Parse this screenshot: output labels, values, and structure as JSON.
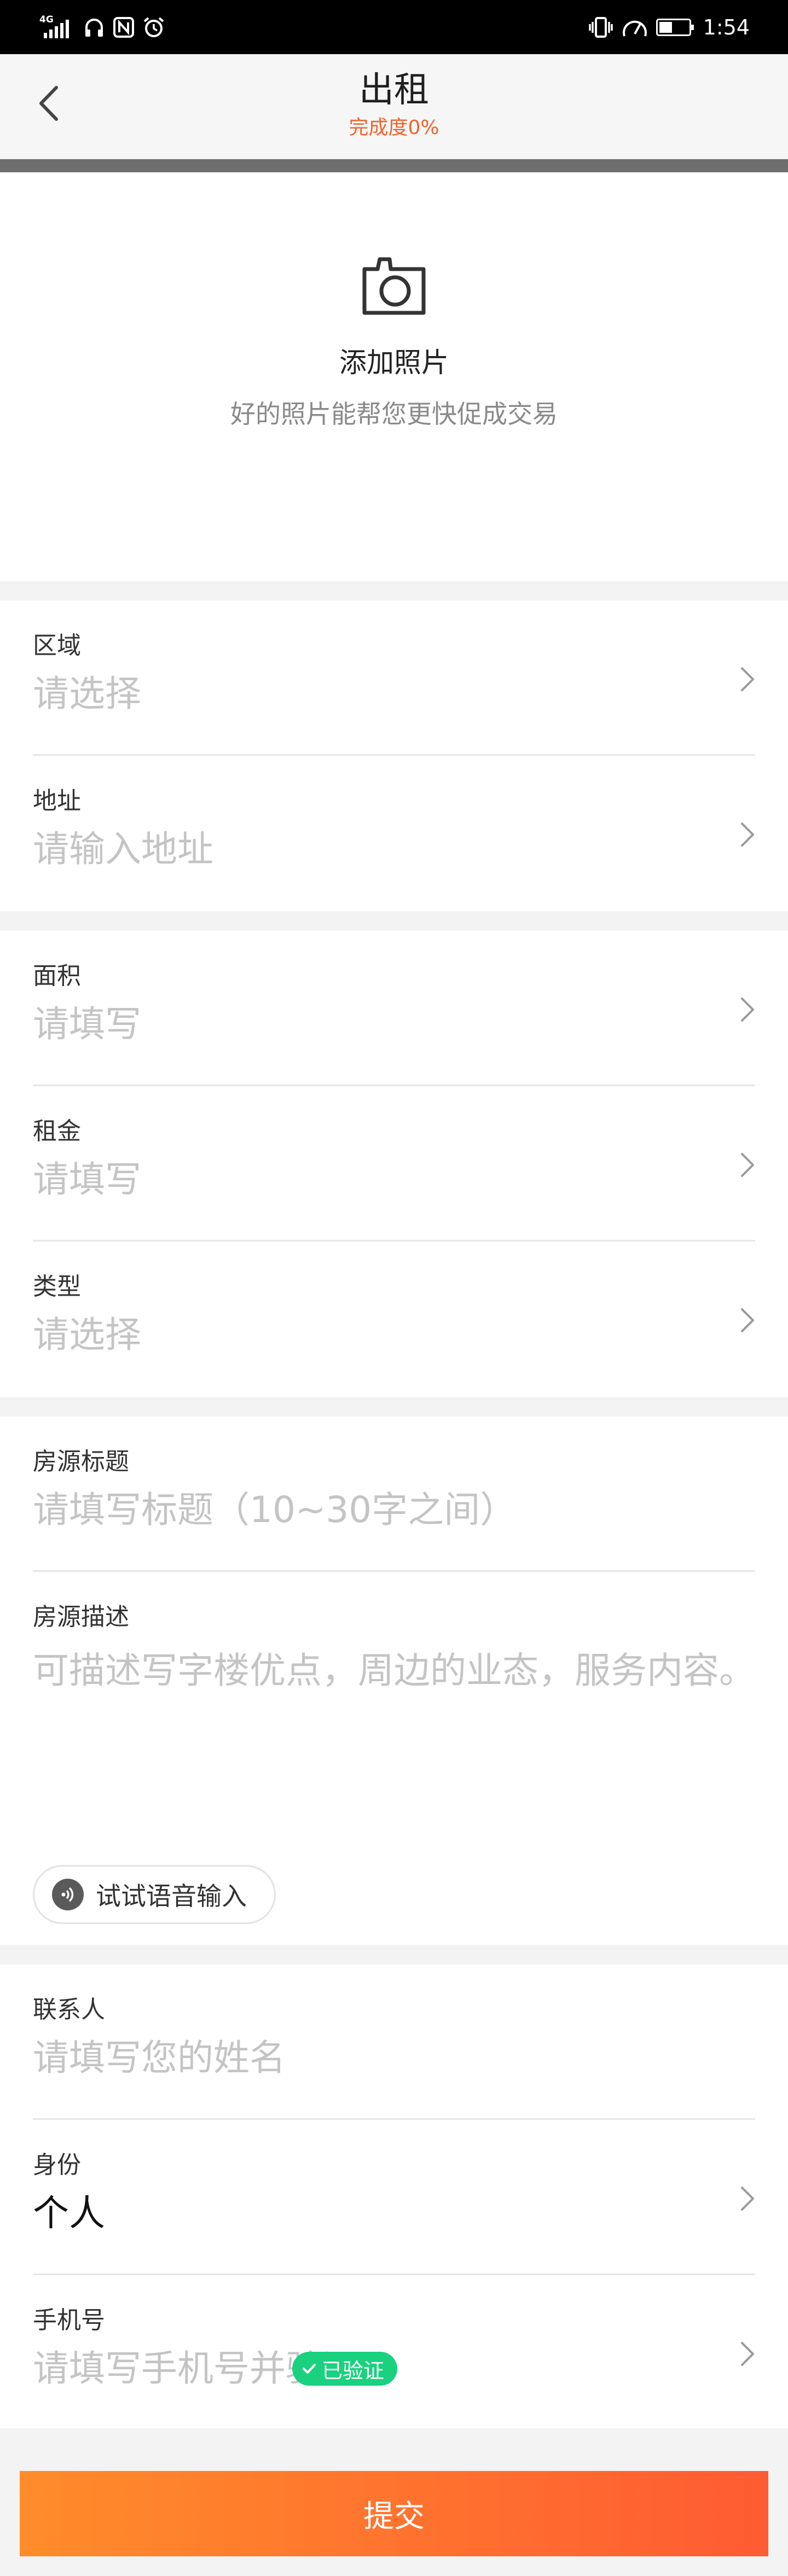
{
  "status_bar": {
    "network": "4G",
    "battery_level": 0.45,
    "time": "1:54"
  },
  "header": {
    "title": "出租",
    "completion": "完成度0%",
    "completion_fraction": 0.0,
    "back_icon": "chevron-left-icon"
  },
  "photo": {
    "icon": "camera-icon",
    "title": "添加照片",
    "hint": "好的照片能帮您更快促成交易"
  },
  "location": {
    "area_label": "区域",
    "area_value": "请选择",
    "address_label": "地址",
    "address_value": "请输入地址"
  },
  "property": {
    "size_label": "面积",
    "size_value": "请填写",
    "rent_label": "租金",
    "rent_value": "请填写",
    "type_label": "类型",
    "type_value": "请选择"
  },
  "listing": {
    "title_label": "房源标题",
    "title_value": "请填写标题（10~30字之间）",
    "desc_label": "房源描述",
    "desc_value": "可描述写字楼优点，周边的业态，服务内容。",
    "voice_label": "试试语音输入"
  },
  "contact": {
    "name_label": "联系人",
    "name_value": "请填写您的姓名",
    "identity_label": "身份",
    "identity_value": "个人",
    "phone_label": "手机号",
    "phone_value": "请填写手机号并验证",
    "verified_label": "已验证"
  },
  "submit_label": "提交",
  "colors": {
    "accent": "#f0642c",
    "verified": "#19d17f",
    "submit_start": "#ff8c2a",
    "submit_end": "#ff5b32"
  }
}
